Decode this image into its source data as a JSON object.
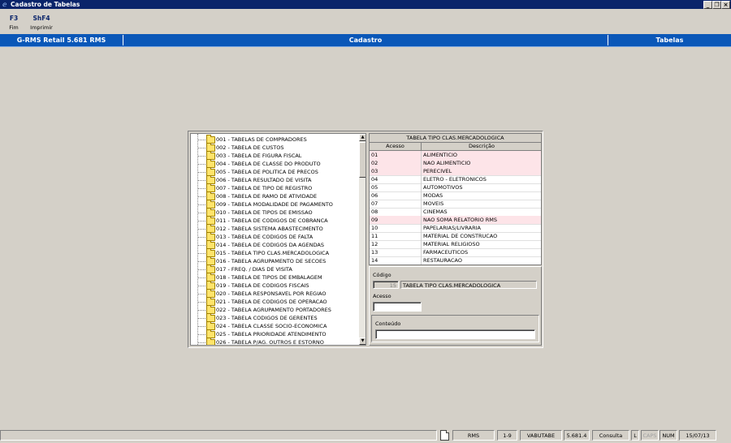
{
  "window": {
    "title": "Cadastro de Tabelas"
  },
  "fkeys": [
    {
      "key": "F3",
      "label": "Fim"
    },
    {
      "key": "ShF4",
      "label": "Imprimir"
    }
  ],
  "header": {
    "app": "G-RMS Retail 5.681 RMS",
    "center": "Cadastro",
    "right": "Tabelas"
  },
  "tree": {
    "items": [
      "001 - TABELAS DE COMPRADORES",
      "002 - TABELA DE CUSTOS",
      "003 - TABELA DE FIGURA FISCAL",
      "004 - TABELA DE CLASSE DO PRODUTO",
      "005 - TABELA DE POLITICA DE PRECOS",
      "006 - TABELA RESULTADO DE VISITA",
      "007 - TABELA DE TIPO DE REGISTRO",
      "008 - TABELA DE RAMO DE ATIVIDADE",
      "009 - TABELA MODALIDADE DE PAGAMENTO",
      "010 - TABELA DE TIPOS DE EMISSAO",
      "011 - TABELA DE CODIGOS DE COBRANCA",
      "012 - TABELA SISTEMA ABASTECIMENTO",
      "013 - TABELA DE CODIGOS DE FALTA",
      "014 - TABELA DE CODIGOS DA AGENDAS",
      "015 - TABELA TIPO CLAS.MERCADOLOGICA",
      "016 - TABELA AGRUPAMENTO DE SECOES",
      "017 - FREQ. / DIAS DE VISITA",
      "018 - TABELA DE TIPOS DE EMBALAGEM",
      "019 - TABELA DE CODIGOS FISCAIS",
      "020 - TABELA RESPONSAVEL POR REGIAO",
      "021 - TABELA DE CODIGOS DE OPERACAO",
      "022 - TABELA AGRUPAMENTO PORTADORES",
      "023 - TABELA CODIGOS DE GERENTES",
      "024 - TABELA CLASSE SOCIO-ECONOMICA",
      "025 - TABELA PRIORIDADE ATENDIMENTO",
      "026 - TABELA P/AG. OUTROS E ESTORNO"
    ]
  },
  "grid": {
    "title": "TABELA TIPO CLAS.MERCADOLOGICA",
    "columns": [
      "Acesso",
      "Descrição"
    ],
    "rows": [
      {
        "acesso": "01",
        "descricao": "ALIMENTICIO",
        "highlight": true
      },
      {
        "acesso": "02",
        "descricao": "NAO ALIMENTICIO",
        "highlight": true
      },
      {
        "acesso": "03",
        "descricao": "PERECIVEL",
        "highlight": true
      },
      {
        "acesso": "04",
        "descricao": "ELETRO - ELETRONICOS",
        "highlight": false
      },
      {
        "acesso": "05",
        "descricao": "AUTOMOTIVOS",
        "highlight": false
      },
      {
        "acesso": "06",
        "descricao": "MODAS",
        "highlight": false
      },
      {
        "acesso": "07",
        "descricao": "MOVEIS",
        "highlight": false
      },
      {
        "acesso": "08",
        "descricao": "CINEMAS",
        "highlight": false
      },
      {
        "acesso": "09",
        "descricao": "NAO SOMA RELATORIO RMS",
        "highlight": true
      },
      {
        "acesso": "10",
        "descricao": "PAPELARIAS/LIVRARIA",
        "highlight": false
      },
      {
        "acesso": "11",
        "descricao": "MATERIAL DE CONSTRUCAO",
        "highlight": false
      },
      {
        "acesso": "12",
        "descricao": "MATERIAL RELIGIOSO",
        "highlight": false
      },
      {
        "acesso": "13",
        "descricao": "FARMACEUTICOS",
        "highlight": false
      },
      {
        "acesso": "14",
        "descricao": "RESTAURACAO",
        "highlight": false
      }
    ]
  },
  "form": {
    "codigo_label": "Código",
    "codigo_value": "15",
    "codigo_desc": "TABELA TIPO CLAS.MERCADOLOGICA",
    "acesso_label": "Acesso",
    "acesso_value": "",
    "conteudo_label": "Conteúdo",
    "conteudo_value": ""
  },
  "status": {
    "user": "RMS",
    "range": "1-9",
    "program": "VABUTABE",
    "version": "5.681.4",
    "mode": "Consulta",
    "l": "L",
    "caps": "CAPS",
    "num": "NUM",
    "date": "15/07/13"
  },
  "colors": {
    "title_bar": "#0a246a",
    "header_bar": "#0a57b8",
    "highlight_row": "#fde4e8",
    "background": "#d4d0c8"
  }
}
